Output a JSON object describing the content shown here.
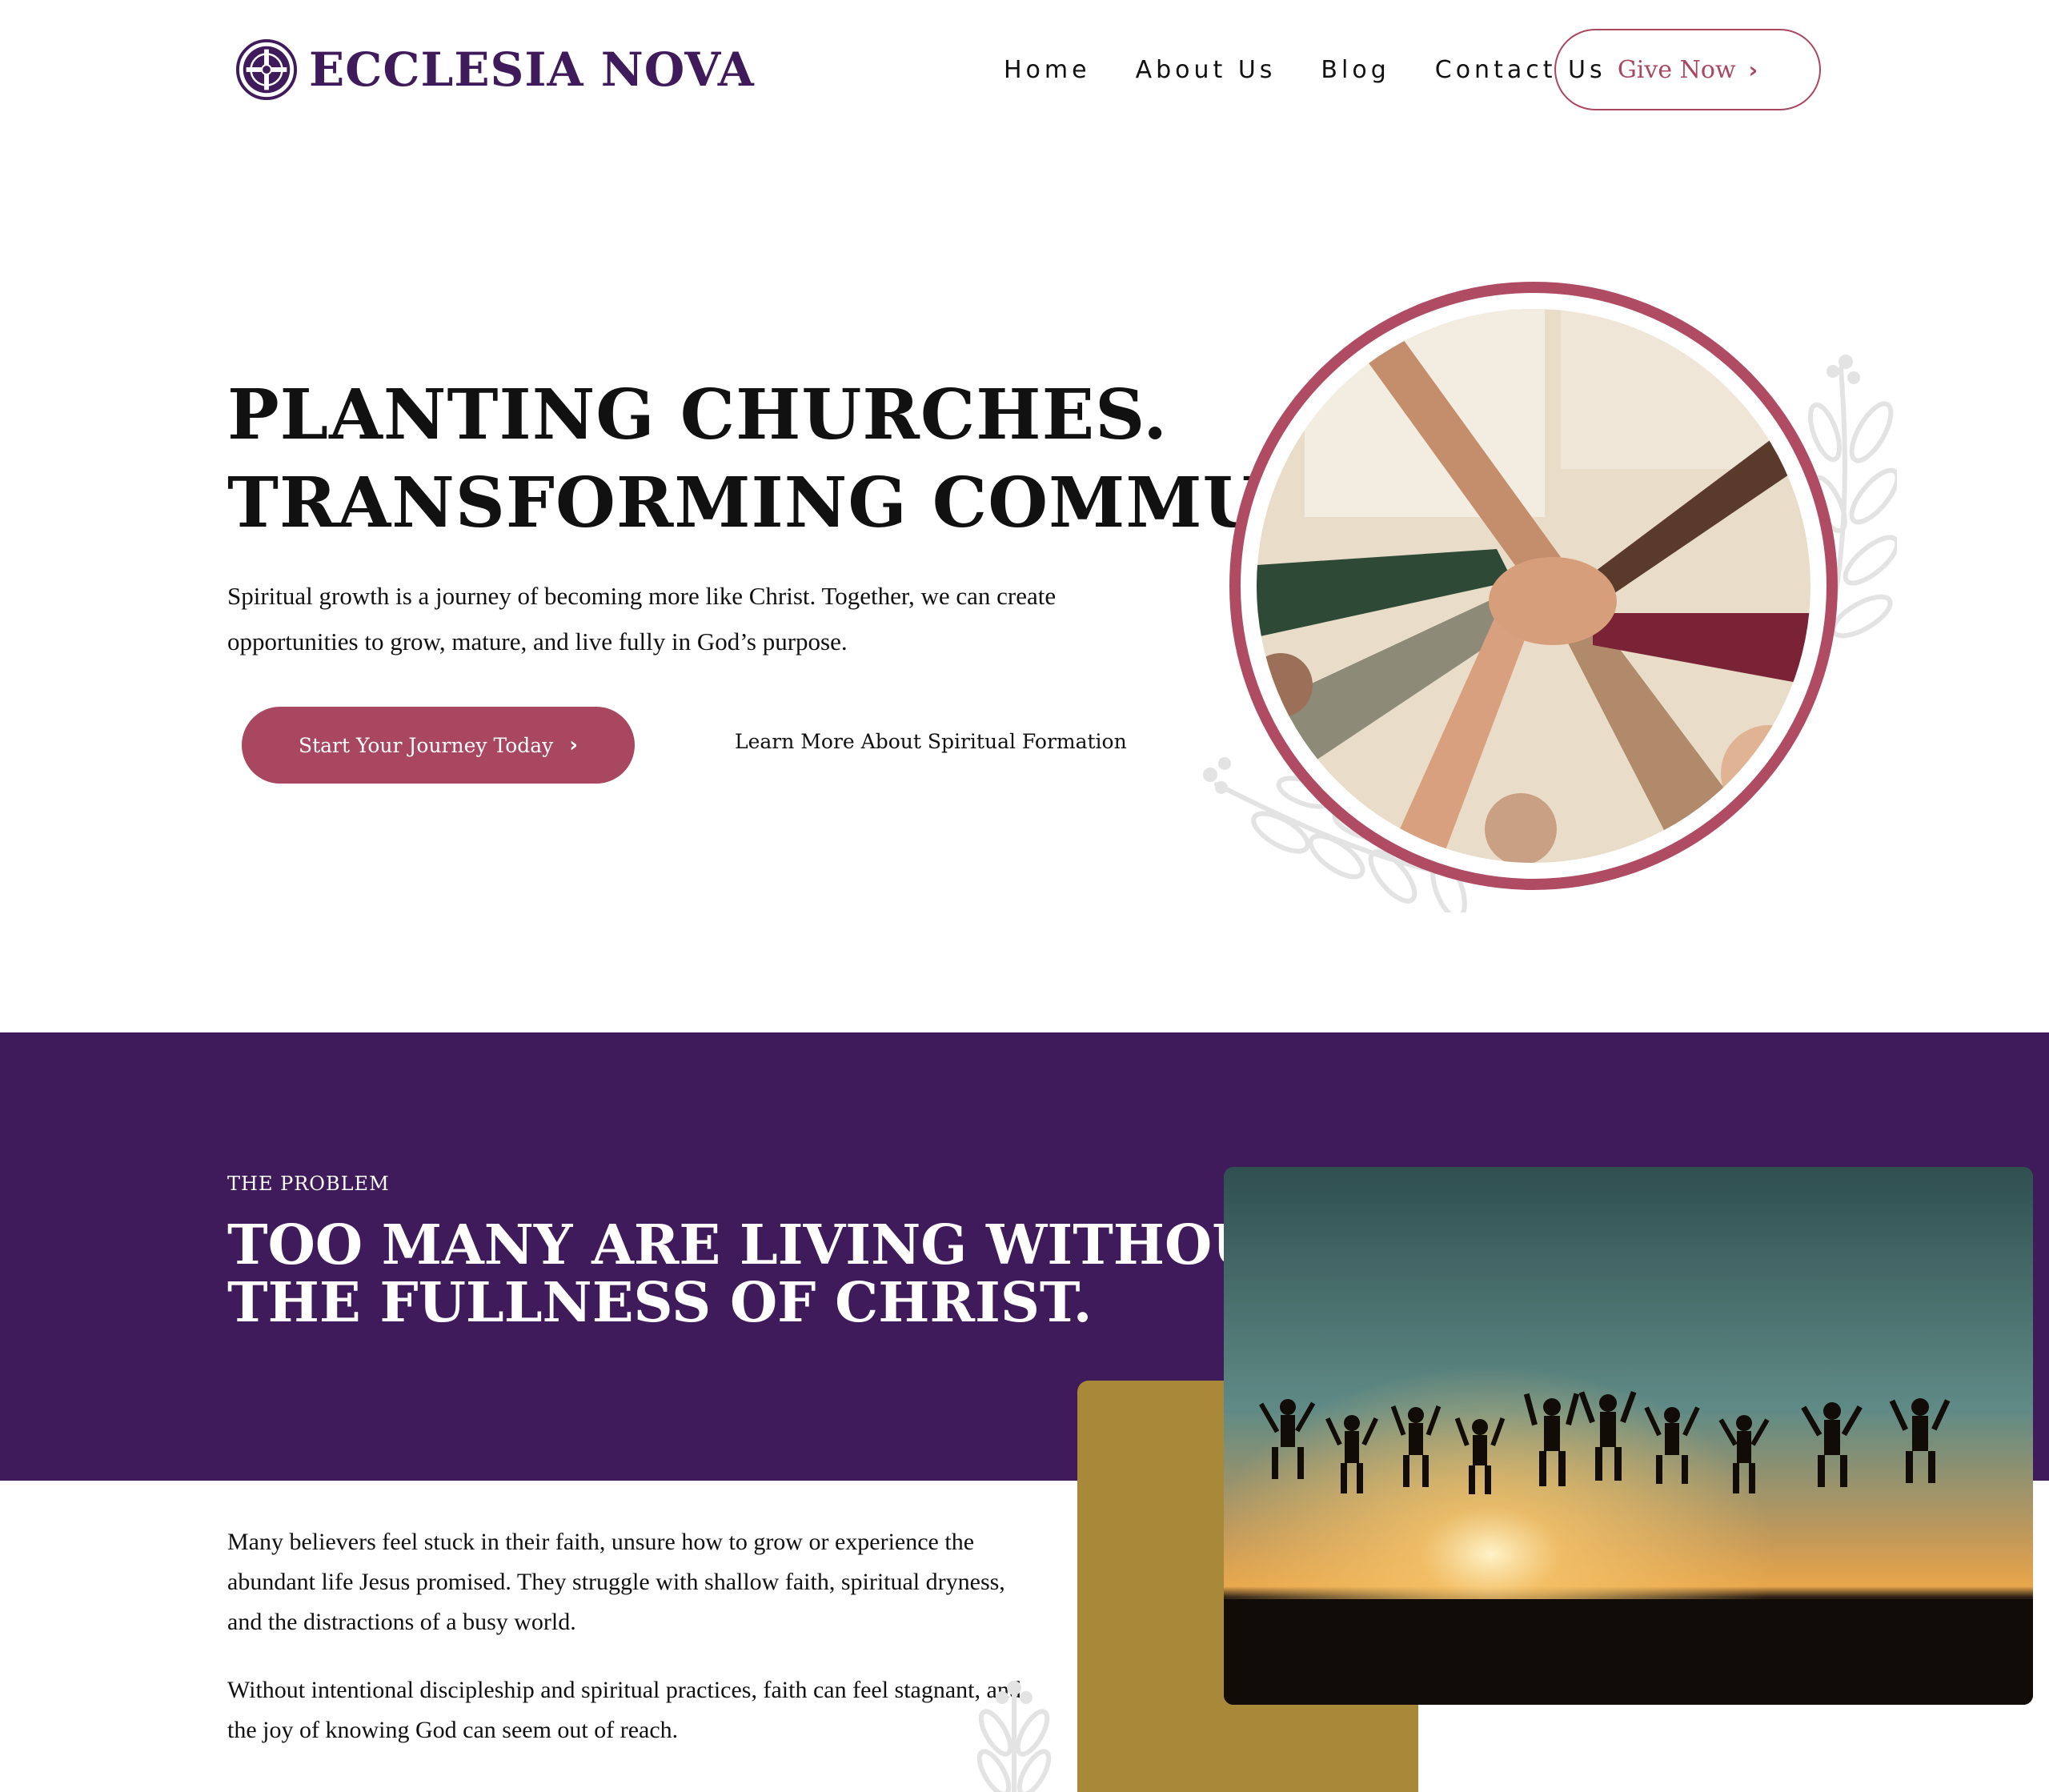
{
  "brand": {
    "name": "ECCLESIA NOVA",
    "color": "#3f1b5b"
  },
  "nav": {
    "items": [
      "Home",
      "About Us",
      "Blog",
      "Contact Us"
    ],
    "give_label": "Give Now"
  },
  "hero": {
    "title_line1": "PLANTING CHURCHES.",
    "title_line2": "TRANSFORMING COMMUNITIES.",
    "text": "Spiritual growth is a journey of becoming more like Christ. Together, we can create opportunities to grow, mature, and live fully in God’s purpose.",
    "primary_cta": "Start Your Journey Today",
    "secondary_cta": "Learn More About Spiritual Formation"
  },
  "problem": {
    "eyebrow": "THE PROBLEM",
    "title_line1": "TOO MANY ARE LIVING WITHOUT",
    "title_line2": "THE FULLNESS OF CHRIST.",
    "para1": "Many believers feel stuck in their faith, unsure how to grow or experience the abundant life Jesus promised. They struggle with shallow faith, spiritual dryness, and the distractions of a busy world.",
    "para2": "Without intentional discipleship and spiritual practices, faith can feel stagnant, and the joy of knowing God can seem out of reach."
  },
  "colors": {
    "accent": "#a8475f",
    "purple": "#3f1b5b",
    "gold": "#a8893a"
  },
  "icons": {
    "logo": "celtic-cross-icon",
    "chevron": "chevron-right-icon"
  }
}
